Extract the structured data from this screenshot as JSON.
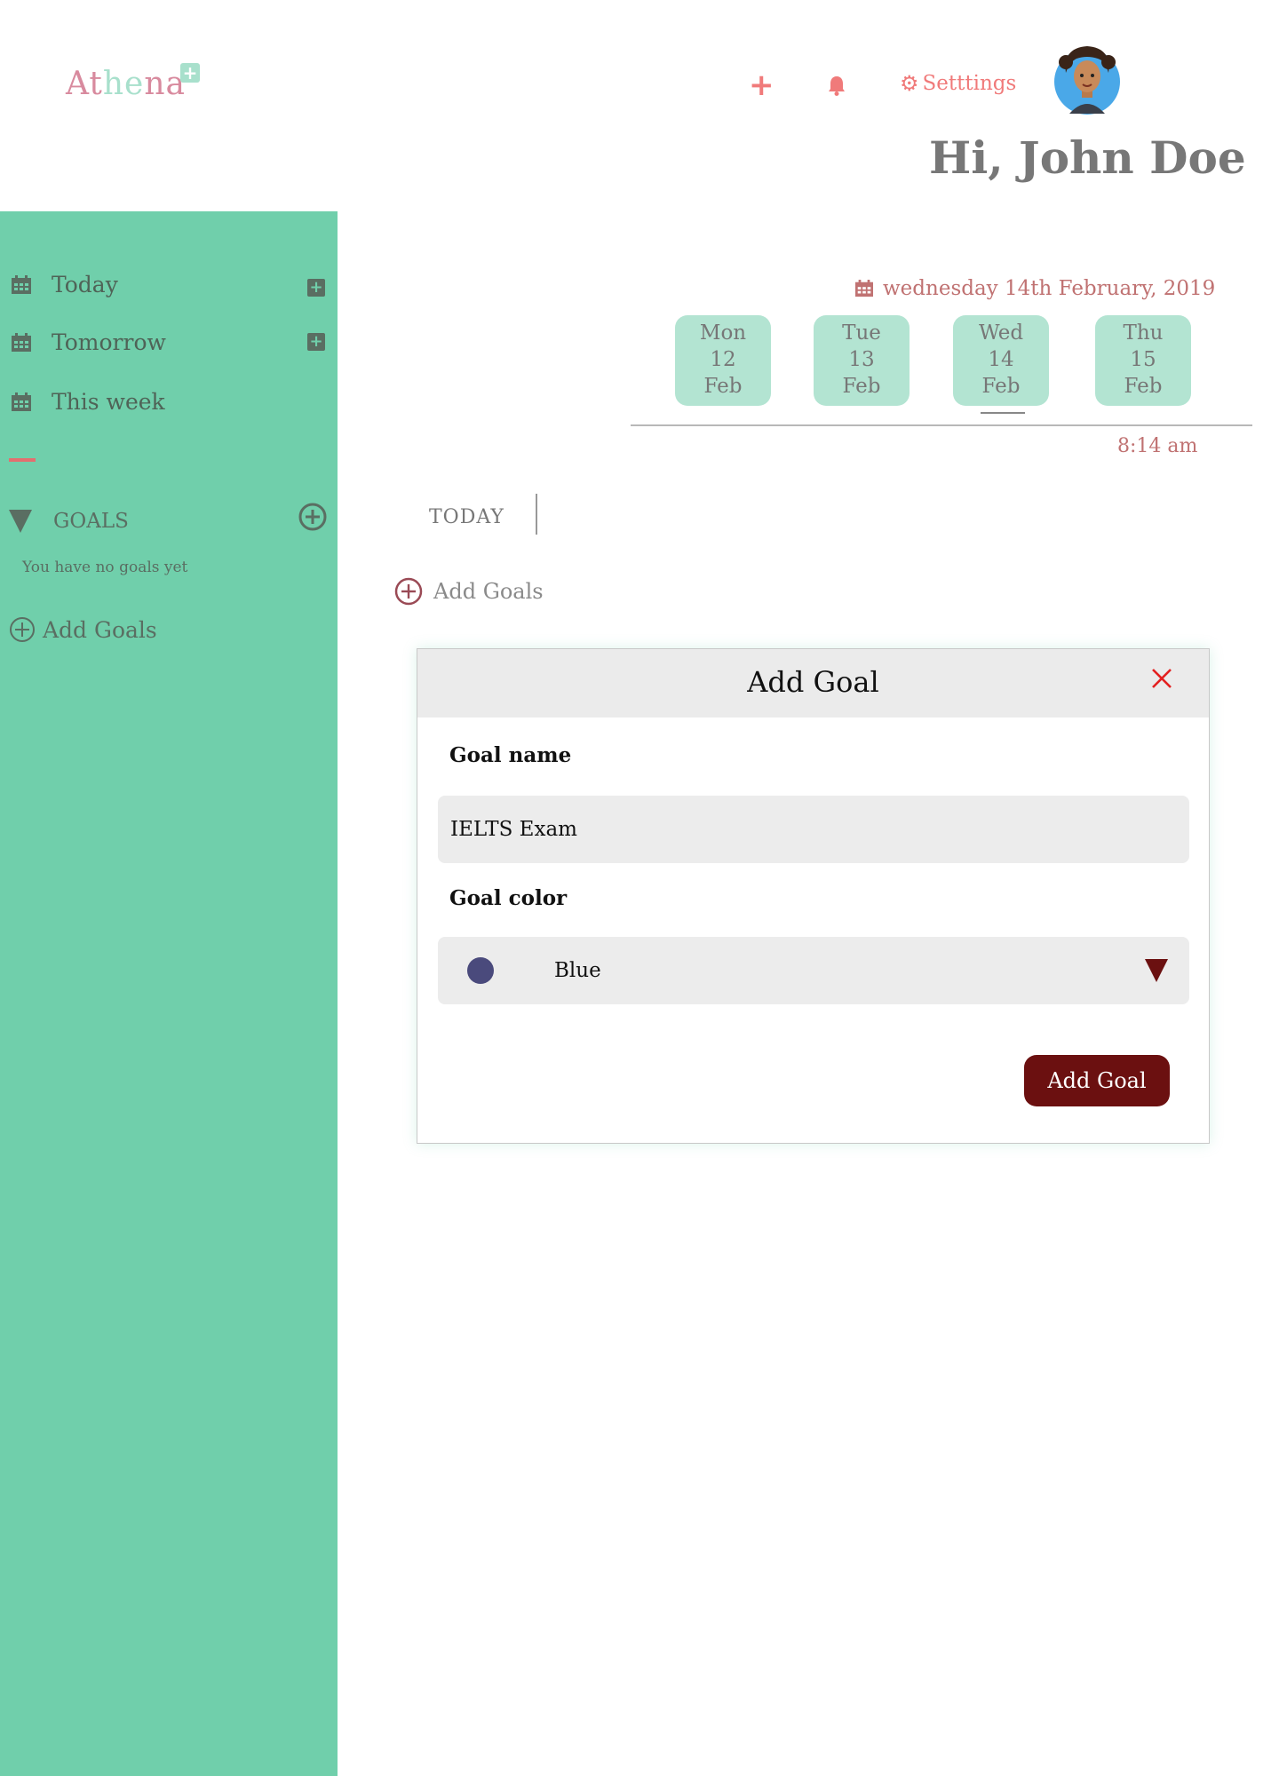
{
  "app": {
    "logo_part1": "At",
    "logo_part2": "he",
    "logo_part3": "na"
  },
  "header": {
    "settings_label": "Setttings",
    "greeting": "Hi, John Doe"
  },
  "sidebar": {
    "items": [
      {
        "label": "Today"
      },
      {
        "label": "Tomorrow"
      },
      {
        "label": "This week"
      }
    ],
    "goals_heading": "GOALS",
    "no_goals_text": "You have no goals yet",
    "add_goals_label": "Add Goals"
  },
  "dates": {
    "current_date": "wednesday 14th February, 2019",
    "days": [
      {
        "weekday": "Mon",
        "day": "12",
        "month": "Feb"
      },
      {
        "weekday": "Tue",
        "day": "13",
        "month": "Feb"
      },
      {
        "weekday": "Wed",
        "day": "14",
        "month": "Feb",
        "selected": true
      },
      {
        "weekday": "Thu",
        "day": "15",
        "month": "Feb"
      }
    ],
    "time": "8:14 am"
  },
  "main": {
    "today_label": "TODAY",
    "add_goals_label": "Add Goals"
  },
  "modal": {
    "title": "Add Goal",
    "goal_name_label": "Goal name",
    "goal_name_value": "IELTS Exam",
    "goal_color_label": "Goal color",
    "goal_color_value": "Blue",
    "submit_label": "Add Goal"
  },
  "colors": {
    "sidebar": "#70cfab",
    "accent": "#f07a7a",
    "button": "#6b1010",
    "day_card": "#b3e4d2",
    "goal_color_swatch": "#4a4a7c"
  }
}
